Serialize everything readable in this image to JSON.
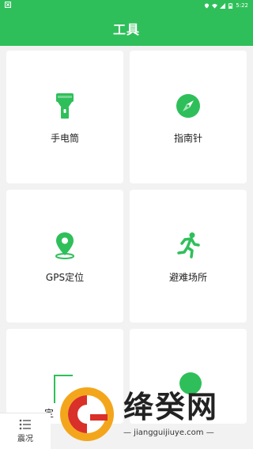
{
  "statusbar": {
    "time": "5:22",
    "left_icon": "x-badge-icon"
  },
  "appbar": {
    "title": "工具"
  },
  "tools": [
    {
      "label": "手电筒",
      "icon": "flashlight-icon"
    },
    {
      "label": "指南针",
      "icon": "compass-icon"
    },
    {
      "label": "GPS定位",
      "icon": "location-pin-icon"
    },
    {
      "label": "避难场所",
      "icon": "running-person-icon"
    }
  ],
  "partial_card_text": "定",
  "bottom_nav": {
    "label": "震况"
  },
  "watermark": {
    "text": "绛癸网",
    "url": "— jiangguijiuye.com —"
  },
  "colors": {
    "primary": "#2fbf5a",
    "background": "#f2f2f2"
  }
}
